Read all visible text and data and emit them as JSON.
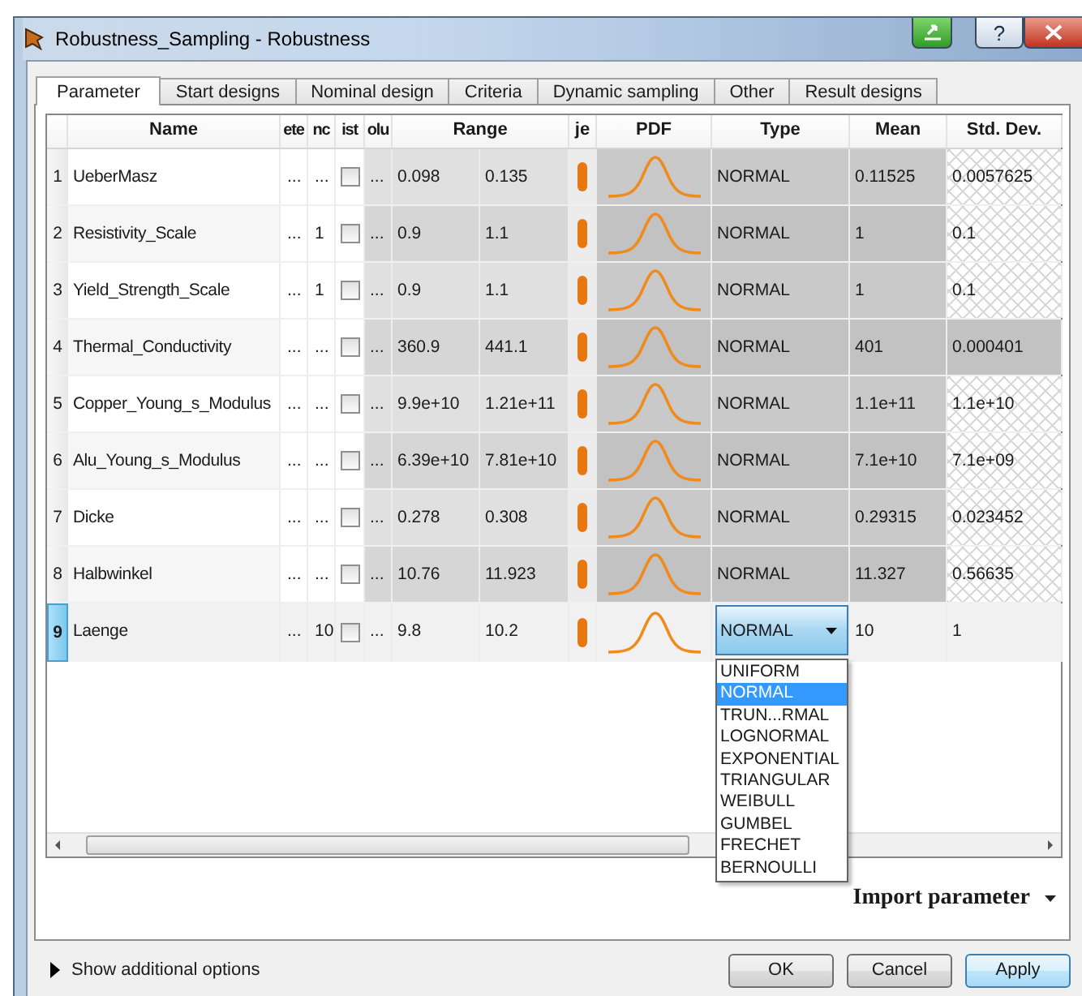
{
  "window": {
    "title": "Robustness_Sampling - Robustness",
    "help_button": "?"
  },
  "tabs": [
    {
      "label": "Parameter",
      "selected": true
    },
    {
      "label": "Start designs",
      "selected": false
    },
    {
      "label": "Nominal design",
      "selected": false
    },
    {
      "label": "Criteria",
      "selected": false
    },
    {
      "label": "Dynamic sampling",
      "selected": false
    },
    {
      "label": "Other",
      "selected": false
    },
    {
      "label": "Result designs",
      "selected": false
    }
  ],
  "table": {
    "columns": [
      "Name",
      "ete",
      "nc",
      "ist",
      "olu",
      "Range",
      "je",
      "PDF",
      "Type",
      "Mean",
      "Std. Dev."
    ],
    "rows": [
      {
        "number": "1",
        "name": "UeberMasz",
        "col_3": "...",
        "col_4": "...",
        "checked": false,
        "col_6": "...",
        "range_min": "0.098",
        "range_max": "0.135",
        "type": "NORMAL",
        "mean": "0.11525",
        "std_dev": "0.0057625",
        "std_dev_hatched": true,
        "selected": false
      },
      {
        "number": "2",
        "name": "Resistivity_Scale",
        "col_3": "...",
        "col_4": "1",
        "checked": false,
        "col_6": "...",
        "range_min": "0.9",
        "range_max": "1.1",
        "type": "NORMAL",
        "mean": "1",
        "std_dev": "0.1",
        "std_dev_hatched": true,
        "selected": false
      },
      {
        "number": "3",
        "name": "Yield_Strength_Scale",
        "col_3": "...",
        "col_4": "1",
        "checked": false,
        "col_6": "...",
        "range_min": "0.9",
        "range_max": "1.1",
        "type": "NORMAL",
        "mean": "1",
        "std_dev": "0.1",
        "std_dev_hatched": true,
        "selected": false
      },
      {
        "number": "4",
        "name": "Thermal_Conductivity",
        "col_3": "...",
        "col_4": "...",
        "checked": false,
        "col_6": "...",
        "range_min": "360.9",
        "range_max": "441.1",
        "type": "NORMAL",
        "mean": "401",
        "std_dev": "0.000401",
        "std_dev_hatched": false,
        "selected": false
      },
      {
        "number": "5",
        "name": "Copper_Young_s_Modulus",
        "col_3": "...",
        "col_4": "...",
        "checked": false,
        "col_6": "...",
        "range_min": "9.9e+10",
        "range_max": "1.21e+11",
        "type": "NORMAL",
        "mean": "1.1e+11",
        "std_dev": "1.1e+10",
        "std_dev_hatched": true,
        "selected": false
      },
      {
        "number": "6",
        "name": "Alu_Young_s_Modulus",
        "col_3": "...",
        "col_4": "...",
        "checked": false,
        "col_6": "...",
        "range_min": "6.39e+10",
        "range_max": "7.81e+10",
        "type": "NORMAL",
        "mean": "7.1e+10",
        "std_dev": "7.1e+09",
        "std_dev_hatched": true,
        "selected": false
      },
      {
        "number": "7",
        "name": "Dicke",
        "col_3": "...",
        "col_4": "...",
        "checked": false,
        "col_6": "...",
        "range_min": "0.278",
        "range_max": "0.308",
        "type": "NORMAL",
        "mean": "0.29315",
        "std_dev": "0.023452",
        "std_dev_hatched": true,
        "selected": false
      },
      {
        "number": "8",
        "name": "Halbwinkel",
        "col_3": "...",
        "col_4": "...",
        "checked": false,
        "col_6": "...",
        "range_min": "10.76",
        "range_max": "11.923",
        "type": "NORMAL",
        "mean": "11.327",
        "std_dev": "0.56635",
        "std_dev_hatched": true,
        "selected": false
      },
      {
        "number": "9",
        "name": "Laenge",
        "col_3": "...",
        "col_4": "10",
        "checked": false,
        "col_6": "...",
        "range_min": "9.8",
        "range_max": "10.2",
        "type": "NORMAL",
        "mean": "10",
        "std_dev": "1",
        "std_dev_hatched": false,
        "selected": true,
        "type_options": [
          {
            "label": "UNIFORM",
            "selected": false
          },
          {
            "label": "NORMAL",
            "selected": true
          },
          {
            "label": "TRUN...RMAL",
            "selected": false
          },
          {
            "label": "LOGNORMAL",
            "selected": false
          },
          {
            "label": "EXPONENTIAL",
            "selected": false
          },
          {
            "label": "TRIANGULAR",
            "selected": false
          },
          {
            "label": "WEIBULL",
            "selected": false
          },
          {
            "label": "GUMBEL",
            "selected": false
          },
          {
            "label": "FRECHET",
            "selected": false
          },
          {
            "label": "BERNOULLI",
            "selected": false
          }
        ]
      }
    ]
  },
  "import_button": "Import parameter",
  "additional_options": {
    "label": "Show additional options",
    "expanded": false
  },
  "buttons": [
    {
      "label": "OK",
      "default": false
    },
    {
      "label": "Cancel",
      "default": false
    },
    {
      "label": "Apply",
      "default": true
    }
  ]
}
